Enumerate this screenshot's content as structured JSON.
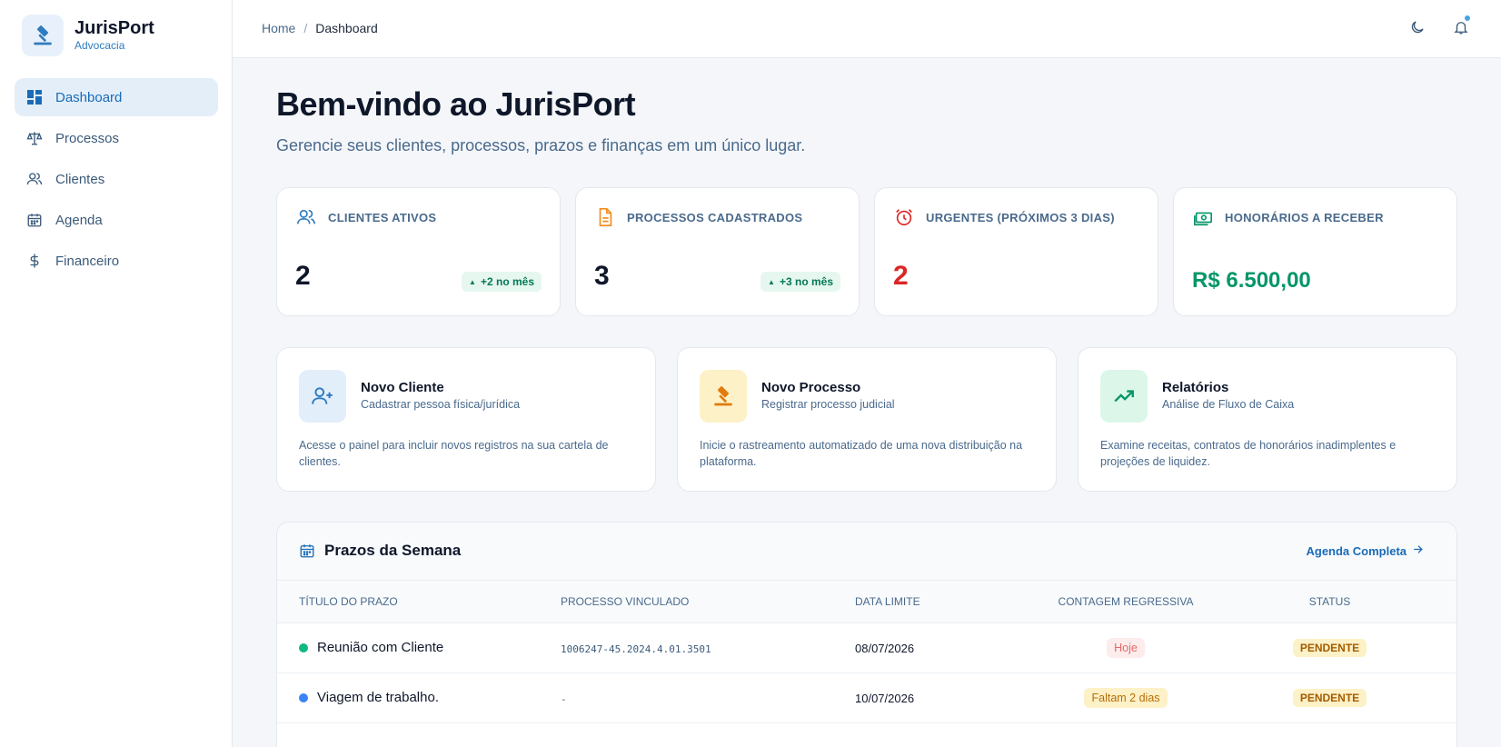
{
  "brand": {
    "name": "JurisPort",
    "subtitle": "Advocacia"
  },
  "nav": [
    {
      "label": "Dashboard",
      "icon": "dashboard-icon",
      "active": true
    },
    {
      "label": "Processos",
      "icon": "scale-icon"
    },
    {
      "label": "Clientes",
      "icon": "users-icon"
    },
    {
      "label": "Agenda",
      "icon": "calendar-icon"
    },
    {
      "label": "Financeiro",
      "icon": "dollar-icon"
    }
  ],
  "breadcrumb": {
    "home": "Home",
    "separator": "/",
    "current": "Dashboard"
  },
  "welcome": {
    "title": "Bem-vindo ao JurisPort",
    "subtitle": "Gerencie seus clientes, processos, prazos e finanças em um único lugar."
  },
  "stats": [
    {
      "label": "CLIENTES ATIVOS",
      "value": "2",
      "badge": "+2 no mês",
      "icon": "users-icon",
      "color": "#2f7bbf"
    },
    {
      "label": "PROCESSOS CADASTRADOS",
      "value": "3",
      "badge": "+3 no mês",
      "icon": "document-icon",
      "color": "#f08c1a"
    },
    {
      "label": "URGENTES (PRÓXIMOS 3 DIAS)",
      "value": "2",
      "icon": "alarm-icon",
      "color": "#dc2626"
    },
    {
      "label": "HONORÁRIOS A RECEBER",
      "value": "R$ 6.500,00",
      "icon": "money-icon",
      "color": "#059669"
    }
  ],
  "actions": [
    {
      "title": "Novo Cliente",
      "subtitle": "Cadastrar pessoa física/jurídica",
      "description": "Acesse o painel para incluir novos registros na sua cartela de clientes.",
      "icon": "add-user-icon"
    },
    {
      "title": "Novo Processo",
      "subtitle": "Registrar processo judicial",
      "description": "Inicie o rastreamento automatizado de uma nova distribuição na plataforma.",
      "icon": "gavel-icon"
    },
    {
      "title": "Relatórios",
      "subtitle": "Análise de Fluxo de Caixa",
      "description": "Examine receitas, contratos de honorários inadimplentes e projeções de liquidez.",
      "icon": "trending-up-icon"
    }
  ],
  "deadlines": {
    "title": "Prazos da Semana",
    "link": "Agenda Completa",
    "columns": [
      "TÍTULO DO PRAZO",
      "PROCESSO VINCULADO",
      "DATA LIMITE",
      "CONTAGEM REGRESSIVA",
      "STATUS"
    ],
    "rows": [
      {
        "title": "Reunião com Cliente",
        "process": "1006247-45.2024.4.01.3501",
        "date": "08/07/2026",
        "countdown": "Hoje",
        "status": "PENDENTE",
        "dot_color": "#10b981"
      },
      {
        "title": "Viagem de trabalho.",
        "process": "-",
        "date": "10/07/2026",
        "countdown": "Faltam 2 dias",
        "status": "PENDENTE",
        "dot_color": "#3b82f6"
      }
    ]
  },
  "colors": {
    "accent": "#1a6bb8",
    "danger": "#dc2626",
    "success": "#059669"
  }
}
